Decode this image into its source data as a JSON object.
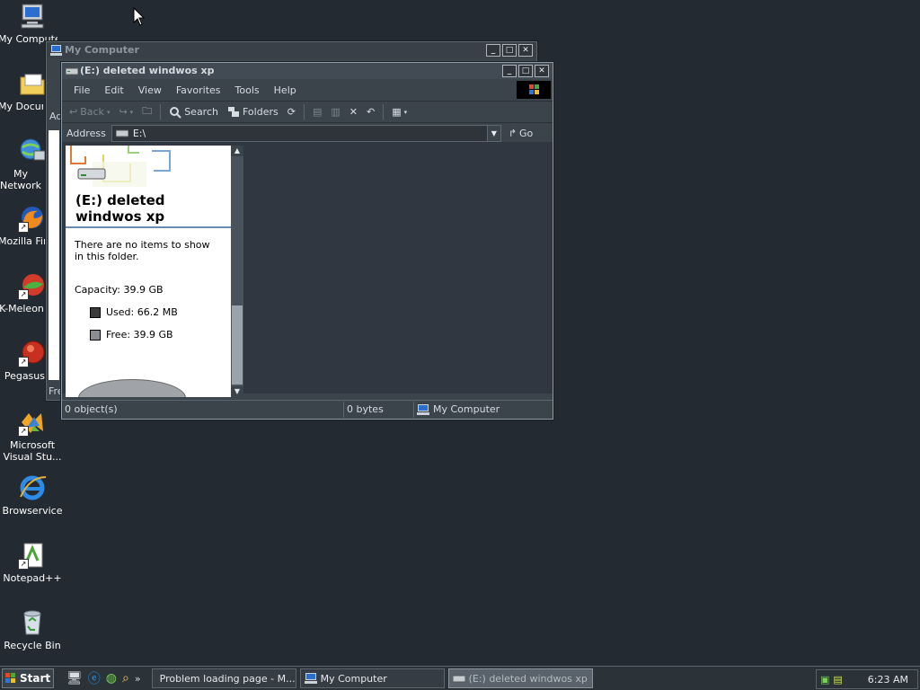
{
  "desktop": {
    "icons": [
      {
        "label": "My Computer",
        "icon": "computer-icon"
      },
      {
        "label": "My Documents",
        "icon": "folder-icon"
      },
      {
        "label": "My Network Places",
        "icon": "network-icon"
      },
      {
        "label": "Mozilla Firefox",
        "icon": "firefox-icon"
      },
      {
        "label": "K-Meleon",
        "icon": "kmeleon-icon"
      },
      {
        "label": "Pegasus",
        "icon": "pegasus-icon"
      },
      {
        "label": "Microsoft Visual Stu...",
        "icon": "visual-studio-icon"
      },
      {
        "label": "Browservice",
        "icon": "ie-icon"
      },
      {
        "label": "Notepad++",
        "icon": "notepad-icon"
      },
      {
        "label": "Recycle Bin",
        "icon": "recycle-bin-icon"
      }
    ]
  },
  "back_window": {
    "title": "My Computer",
    "partial_text_1": "Ad",
    "partial_text_2": "Fre"
  },
  "window": {
    "title": "(E:) deleted windwos xp",
    "buttons": {
      "minimize": "_",
      "maximize": "□",
      "close": "✕"
    },
    "menu": [
      "File",
      "Edit",
      "View",
      "Favorites",
      "Tools",
      "Help"
    ],
    "toolbar": {
      "back": "Back",
      "search": "Search",
      "folders": "Folders"
    },
    "address": {
      "label": "Address",
      "value": "E:\\",
      "go": "Go"
    },
    "taskpane": {
      "title": "(E:) deleted windwos xp",
      "empty_message": "There are no items to show in this folder.",
      "capacity": "Capacity: 39.9 GB",
      "used": "Used: 66.2 MB",
      "free": "Free: 39.9 GB",
      "used_color": "#3a3a3a",
      "free_color": "#8a8e92"
    },
    "status": {
      "objects": "0 object(s)",
      "size": "0 bytes",
      "location": "My Computer"
    }
  },
  "taskbar": {
    "start": "Start",
    "chevron": "»",
    "tasks": [
      {
        "label": "Problem loading page - M...",
        "icon": "firefox-icon"
      },
      {
        "label": "My Computer",
        "icon": "computer-icon"
      },
      {
        "label": "(E:) deleted windwos xp",
        "icon": "drive-icon",
        "active": true
      }
    ],
    "clock": "6:23 AM"
  }
}
